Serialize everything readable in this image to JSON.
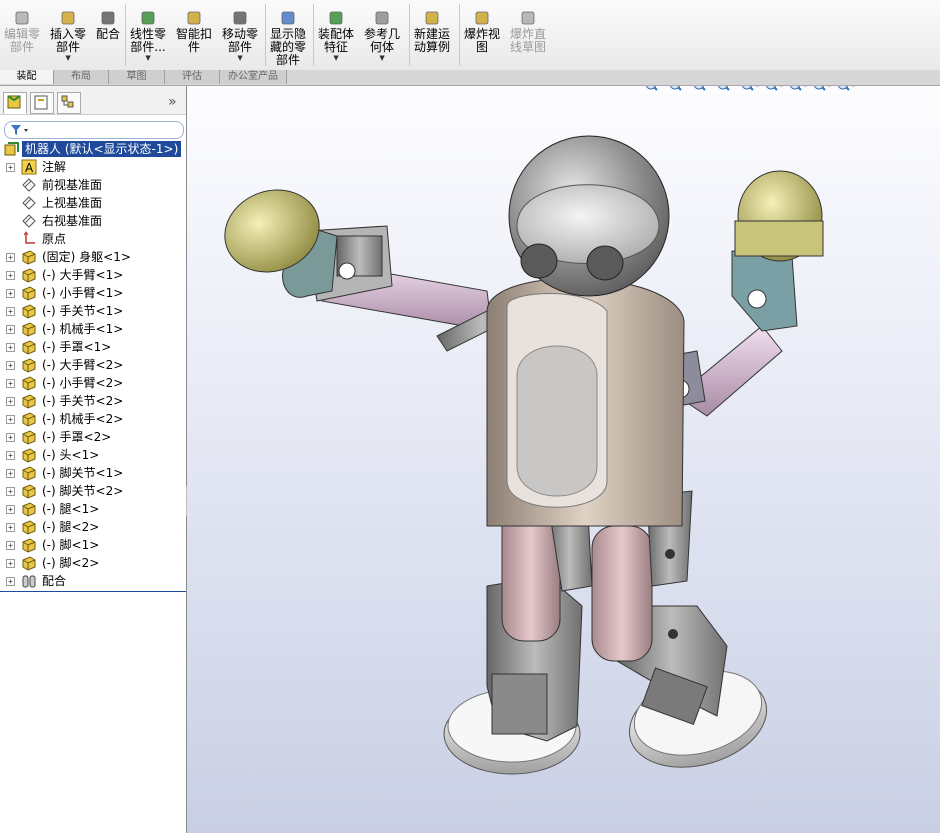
{
  "toolbar": {
    "items": [
      {
        "label": "编辑零\n部件",
        "icon": "edit-component-icon",
        "disabled": true,
        "dropdown": false
      },
      {
        "label": "插入零\n部件",
        "icon": "insert-component-icon",
        "disabled": false,
        "dropdown": true
      },
      {
        "label": "配合",
        "icon": "mate-icon",
        "disabled": false,
        "dropdown": false
      },
      {
        "label": "线性零\n部件...",
        "icon": "linear-pattern-icon",
        "disabled": false,
        "dropdown": true
      },
      {
        "label": "智能扣\n件",
        "icon": "smart-fastener-icon",
        "disabled": false,
        "dropdown": false
      },
      {
        "label": "移动零\n部件",
        "icon": "move-component-icon",
        "disabled": false,
        "dropdown": true
      },
      {
        "label": "显示隐\n藏的零\n部件",
        "icon": "show-hidden-icon",
        "disabled": false,
        "dropdown": false
      },
      {
        "label": "装配体\n特征",
        "icon": "assembly-feature-icon",
        "disabled": false,
        "dropdown": true
      },
      {
        "label": "参考几\n何体",
        "icon": "reference-geometry-icon",
        "disabled": false,
        "dropdown": true
      },
      {
        "label": "新建运\n动算例",
        "icon": "motion-study-icon",
        "disabled": false,
        "dropdown": false
      },
      {
        "label": "爆炸视\n图",
        "icon": "exploded-view-icon",
        "disabled": false,
        "dropdown": false
      },
      {
        "label": "爆炸直\n线草图",
        "icon": "explode-line-sketch-icon",
        "disabled": true,
        "dropdown": false
      }
    ]
  },
  "tabs": [
    "装配",
    "布局",
    "草图",
    "评估",
    "办公室产品"
  ],
  "active_tab": 0,
  "tree": {
    "root": "机器人 (默认<显示状态-1>)",
    "items": [
      {
        "label": "注解",
        "icon": "annotation-icon",
        "expand": true
      },
      {
        "label": "前视基准面",
        "icon": "plane-icon",
        "expand": false
      },
      {
        "label": "上视基准面",
        "icon": "plane-icon",
        "expand": false
      },
      {
        "label": "右视基准面",
        "icon": "plane-icon",
        "expand": false
      },
      {
        "label": "原点",
        "icon": "origin-icon",
        "expand": false
      },
      {
        "label": "(固定) 身躯<1>",
        "icon": "part-icon",
        "expand": true
      },
      {
        "label": "(-) 大手臂<1>",
        "icon": "part-icon",
        "expand": true
      },
      {
        "label": "(-) 小手臂<1>",
        "icon": "part-icon",
        "expand": true
      },
      {
        "label": "(-) 手关节<1>",
        "icon": "part-icon",
        "expand": true
      },
      {
        "label": "(-) 机械手<1>",
        "icon": "part-icon",
        "expand": true
      },
      {
        "label": "(-) 手罩<1>",
        "icon": "part-icon",
        "expand": true
      },
      {
        "label": "(-) 大手臂<2>",
        "icon": "part-icon",
        "expand": true
      },
      {
        "label": "(-) 小手臂<2>",
        "icon": "part-icon",
        "expand": true
      },
      {
        "label": "(-) 手关节<2>",
        "icon": "part-icon",
        "expand": true
      },
      {
        "label": "(-) 机械手<2>",
        "icon": "part-icon",
        "expand": true
      },
      {
        "label": "(-) 手罩<2>",
        "icon": "part-icon",
        "expand": true
      },
      {
        "label": "(-) 头<1>",
        "icon": "part-icon",
        "expand": true
      },
      {
        "label": "(-) 脚关节<1>",
        "icon": "part-icon",
        "expand": true
      },
      {
        "label": "(-) 脚关节<2>",
        "icon": "part-icon",
        "expand": true
      },
      {
        "label": "(-) 腿<1>",
        "icon": "part-icon",
        "expand": true
      },
      {
        "label": "(-) 腿<2>",
        "icon": "part-icon",
        "expand": true
      },
      {
        "label": "(-) 脚<1>",
        "icon": "part-icon",
        "expand": true
      },
      {
        "label": "(-) 脚<2>",
        "icon": "part-icon",
        "expand": true
      },
      {
        "label": "配合",
        "icon": "mates-folder-icon",
        "expand": true
      }
    ]
  },
  "viewbar": [
    "zoom-to-fit-icon",
    "zoom-to-area-icon",
    "previous-view-icon",
    "section-view-icon",
    "view-orientation-icon",
    "display-style-icon",
    "hide-show-items-icon",
    "edit-appearance-icon",
    "apply-scene-icon"
  ],
  "colors": {
    "selection": "#1f4a9c",
    "head": "#7a7a7a",
    "cap": "#c8c47a",
    "torso": "#b9a99a",
    "arm": "#d8bfd2",
    "foot": "#d9d9d9"
  }
}
